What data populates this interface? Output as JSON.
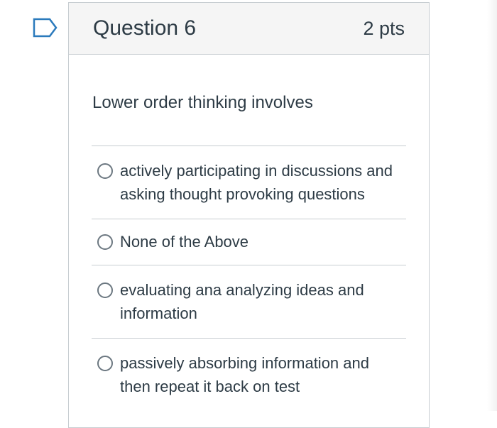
{
  "question": {
    "title": "Question 6",
    "points": "2 pts",
    "text": "Lower order thinking involves",
    "flag_icon": "flag-outline-icon",
    "accent_color": "#2b7abc"
  },
  "answers": [
    {
      "label": "actively participating in discussions and asking thought provoking questions",
      "selected": false
    },
    {
      "label": "None of the Above",
      "selected": false
    },
    {
      "label": "evaluating ana analyzing ideas and information",
      "selected": false
    },
    {
      "label": "passively absorbing information and then repeat it back on test",
      "selected": false
    }
  ]
}
